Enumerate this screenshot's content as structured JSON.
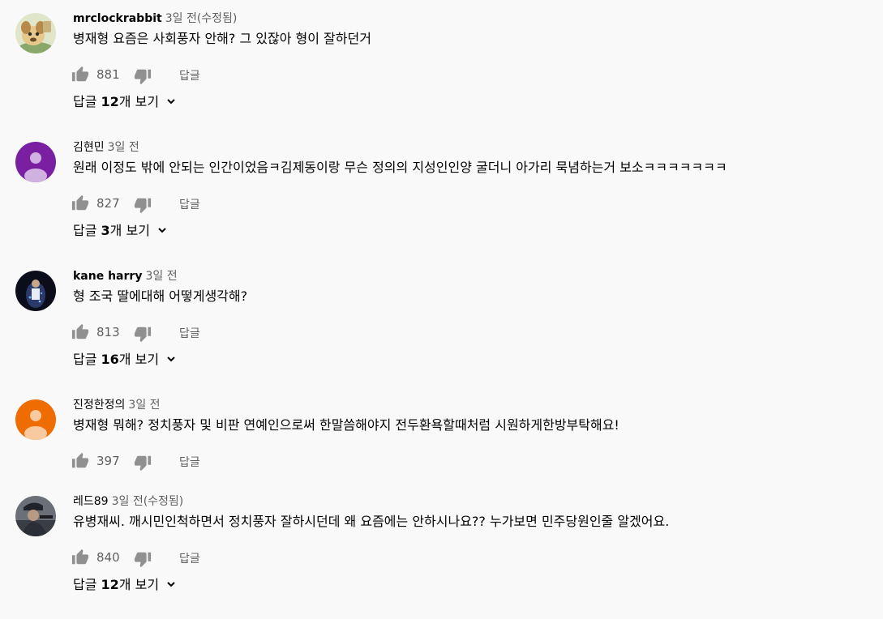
{
  "comments": [
    {
      "author": "mrclockrabbit",
      "time": "3일 전(수정됨)",
      "text": "병재형 요즘은 사회풍자 안해? 그 있잖아 형이 잘하던거",
      "likes": "881",
      "reply_label": "답글",
      "replies": {
        "pre": "답글 ",
        "count": "12",
        "post": "개 보기"
      },
      "avatar": "cartoon-dog-avatar"
    },
    {
      "author": "김현민",
      "time": "3일 전",
      "text": "원래 이정도 밖에 안되는 인간이었음ㅋ김제동이랑 무슨 정의의 지성인인양 굴더니 아가리 묵념하는거 보소ㅋㅋㅋㅋㅋㅋㅋ",
      "likes": "827",
      "reply_label": "답글",
      "replies": {
        "pre": "답글 ",
        "count": "3",
        "post": "개 보기"
      },
      "avatar": "default-purple-avatar",
      "avatar_color": "#7b1fa2"
    },
    {
      "author": "kane harry",
      "time": "3일 전",
      "text": "형 조국 딸에대해 어떻게생각해?",
      "likes": "813",
      "reply_label": "답글",
      "replies": {
        "pre": "답글 ",
        "count": "16",
        "post": "개 보기"
      },
      "avatar": "dark-photo-avatar"
    },
    {
      "author": "진정한정의",
      "time": "3일 전",
      "text": "병재형 뭐해? 정치풍자 및 비판 연예인으로써 한말씀해야지 전두환욕할때처럼 시원하게한방부탁해요!",
      "likes": "397",
      "reply_label": "답글",
      "avatar": "default-orange-avatar",
      "avatar_color": "#ef6c00"
    },
    {
      "author": "레드89",
      "time": "3일 전(수정됨)",
      "text": "유병재씨. 깨시민인척하면서 정치풍자 잘하시던데 왜 요즘에는 안하시나요??  누가보면 민주당원인줄 알겠어요.",
      "likes": "840",
      "reply_label": "답글",
      "replies": {
        "pre": "답글 ",
        "count": "12",
        "post": "개 보기"
      },
      "avatar": "photo-soldier-avatar"
    }
  ]
}
